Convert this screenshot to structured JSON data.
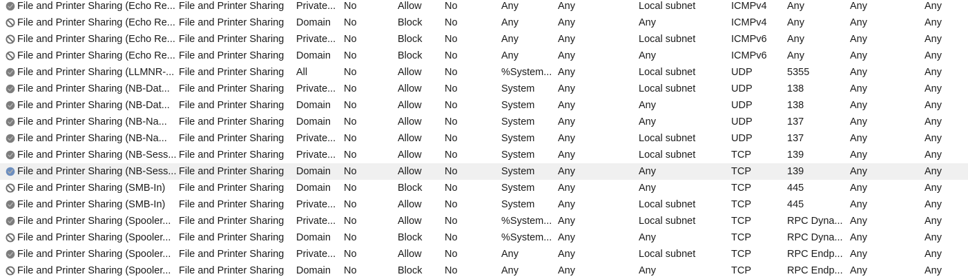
{
  "colors": {
    "allow_icon": "#7d7d7d",
    "block_icon": "#6e6e6e",
    "selected_allow_icon": "#6c8ebf",
    "selected_row_bg": "#f0f0f0"
  },
  "rules": [
    {
      "name": "File and Printer Sharing (Echo Re...",
      "group": "File and Printer Sharing",
      "profile": "Private...",
      "enabled": "No",
      "action": "Allow",
      "override": "No",
      "program": "Any",
      "local_address": "Any",
      "remote_address": "Local subnet",
      "protocol": "ICMPv4",
      "local_port": "Any",
      "remote_port": "Any",
      "authorized_users": "Any",
      "icon": "allow-disabled-icon"
    },
    {
      "name": "File and Printer Sharing (Echo Re...",
      "group": "File and Printer Sharing",
      "profile": "Domain",
      "enabled": "No",
      "action": "Block",
      "override": "No",
      "program": "Any",
      "local_address": "Any",
      "remote_address": "Any",
      "protocol": "ICMPv4",
      "local_port": "Any",
      "remote_port": "Any",
      "authorized_users": "Any",
      "icon": "block-disabled-icon"
    },
    {
      "name": "File and Printer Sharing (Echo Re...",
      "group": "File and Printer Sharing",
      "profile": "Private...",
      "enabled": "No",
      "action": "Block",
      "override": "No",
      "program": "Any",
      "local_address": "Any",
      "remote_address": "Local subnet",
      "protocol": "ICMPv6",
      "local_port": "Any",
      "remote_port": "Any",
      "authorized_users": "Any",
      "icon": "block-disabled-icon"
    },
    {
      "name": "File and Printer Sharing (Echo Re...",
      "group": "File and Printer Sharing",
      "profile": "Domain",
      "enabled": "No",
      "action": "Block",
      "override": "No",
      "program": "Any",
      "local_address": "Any",
      "remote_address": "Any",
      "protocol": "ICMPv6",
      "local_port": "Any",
      "remote_port": "Any",
      "authorized_users": "Any",
      "icon": "block-disabled-icon"
    },
    {
      "name": "File and Printer Sharing (LLMNR-...",
      "group": "File and Printer Sharing",
      "profile": "All",
      "enabled": "No",
      "action": "Allow",
      "override": "No",
      "program": "%System...",
      "local_address": "Any",
      "remote_address": "Local subnet",
      "protocol": "UDP",
      "local_port": "5355",
      "remote_port": "Any",
      "authorized_users": "Any",
      "icon": "allow-disabled-icon"
    },
    {
      "name": "File and Printer Sharing (NB-Dat...",
      "group": "File and Printer Sharing",
      "profile": "Private...",
      "enabled": "No",
      "action": "Allow",
      "override": "No",
      "program": "System",
      "local_address": "Any",
      "remote_address": "Local subnet",
      "protocol": "UDP",
      "local_port": "138",
      "remote_port": "Any",
      "authorized_users": "Any",
      "icon": "allow-disabled-icon"
    },
    {
      "name": "File and Printer Sharing (NB-Dat...",
      "group": "File and Printer Sharing",
      "profile": "Domain",
      "enabled": "No",
      "action": "Allow",
      "override": "No",
      "program": "System",
      "local_address": "Any",
      "remote_address": "Any",
      "protocol": "UDP",
      "local_port": "138",
      "remote_port": "Any",
      "authorized_users": "Any",
      "icon": "allow-disabled-icon"
    },
    {
      "name": "File and Printer Sharing (NB-Na...",
      "group": "File and Printer Sharing",
      "profile": "Domain",
      "enabled": "No",
      "action": "Allow",
      "override": "No",
      "program": "System",
      "local_address": "Any",
      "remote_address": "Any",
      "protocol": "UDP",
      "local_port": "137",
      "remote_port": "Any",
      "authorized_users": "Any",
      "icon": "allow-disabled-icon"
    },
    {
      "name": "File and Printer Sharing (NB-Na...",
      "group": "File and Printer Sharing",
      "profile": "Private...",
      "enabled": "No",
      "action": "Allow",
      "override": "No",
      "program": "System",
      "local_address": "Any",
      "remote_address": "Local subnet",
      "protocol": "UDP",
      "local_port": "137",
      "remote_port": "Any",
      "authorized_users": "Any",
      "icon": "allow-disabled-icon"
    },
    {
      "name": "File and Printer Sharing (NB-Sess...",
      "group": "File and Printer Sharing",
      "profile": "Private...",
      "enabled": "No",
      "action": "Allow",
      "override": "No",
      "program": "System",
      "local_address": "Any",
      "remote_address": "Local subnet",
      "protocol": "TCP",
      "local_port": "139",
      "remote_port": "Any",
      "authorized_users": "Any",
      "icon": "allow-disabled-icon"
    },
    {
      "name": "File and Printer Sharing (NB-Sess...",
      "group": "File and Printer Sharing",
      "profile": "Domain",
      "enabled": "No",
      "action": "Allow",
      "override": "No",
      "program": "System",
      "local_address": "Any",
      "remote_address": "Any",
      "protocol": "TCP",
      "local_port": "139",
      "remote_port": "Any",
      "authorized_users": "Any",
      "icon": "allow-disabled-icon",
      "selected": true
    },
    {
      "name": "File and Printer Sharing (SMB-In)",
      "group": "File and Printer Sharing",
      "profile": "Domain",
      "enabled": "No",
      "action": "Block",
      "override": "No",
      "program": "System",
      "local_address": "Any",
      "remote_address": "Any",
      "protocol": "TCP",
      "local_port": "445",
      "remote_port": "Any",
      "authorized_users": "Any",
      "icon": "block-disabled-icon"
    },
    {
      "name": "File and Printer Sharing (SMB-In)",
      "group": "File and Printer Sharing",
      "profile": "Private...",
      "enabled": "No",
      "action": "Allow",
      "override": "No",
      "program": "System",
      "local_address": "Any",
      "remote_address": "Local subnet",
      "protocol": "TCP",
      "local_port": "445",
      "remote_port": "Any",
      "authorized_users": "Any",
      "icon": "allow-disabled-icon"
    },
    {
      "name": "File and Printer Sharing (Spooler...",
      "group": "File and Printer Sharing",
      "profile": "Private...",
      "enabled": "No",
      "action": "Allow",
      "override": "No",
      "program": "%System...",
      "local_address": "Any",
      "remote_address": "Local subnet",
      "protocol": "TCP",
      "local_port": "RPC Dyna...",
      "remote_port": "Any",
      "authorized_users": "Any",
      "icon": "allow-disabled-icon"
    },
    {
      "name": "File and Printer Sharing (Spooler...",
      "group": "File and Printer Sharing",
      "profile": "Domain",
      "enabled": "No",
      "action": "Block",
      "override": "No",
      "program": "%System...",
      "local_address": "Any",
      "remote_address": "Any",
      "protocol": "TCP",
      "local_port": "RPC Dyna...",
      "remote_port": "Any",
      "authorized_users": "Any",
      "icon": "block-disabled-icon"
    },
    {
      "name": "File and Printer Sharing (Spooler...",
      "group": "File and Printer Sharing",
      "profile": "Private...",
      "enabled": "No",
      "action": "Allow",
      "override": "No",
      "program": "Any",
      "local_address": "Any",
      "remote_address": "Local subnet",
      "protocol": "TCP",
      "local_port": "RPC Endp...",
      "remote_port": "Any",
      "authorized_users": "Any",
      "icon": "allow-disabled-icon"
    },
    {
      "name": "File and Printer Sharing (Spooler...",
      "group": "File and Printer Sharing",
      "profile": "Domain",
      "enabled": "No",
      "action": "Block",
      "override": "No",
      "program": "Any",
      "local_address": "Any",
      "remote_address": "Any",
      "protocol": "TCP",
      "local_port": "RPC Endp...",
      "remote_port": "Any",
      "authorized_users": "Any",
      "icon": "block-disabled-icon"
    }
  ]
}
